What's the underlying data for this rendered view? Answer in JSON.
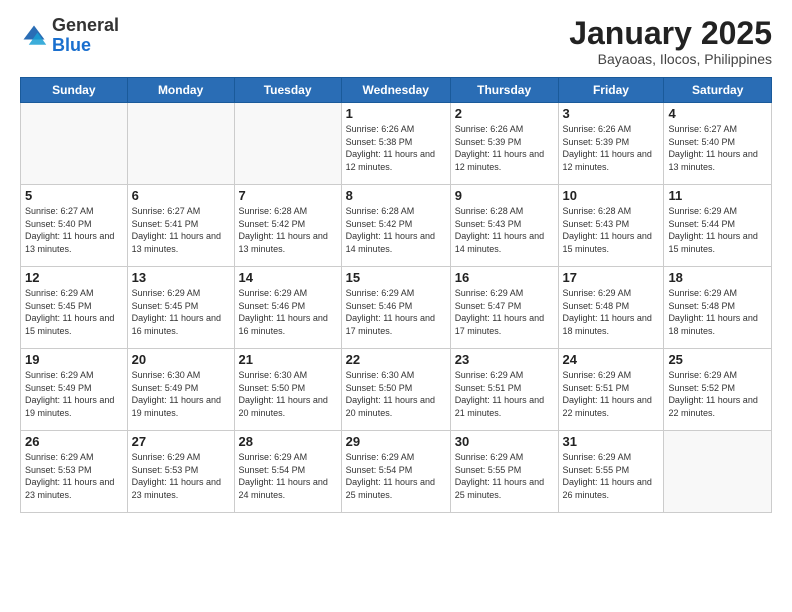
{
  "logo": {
    "general": "General",
    "blue": "Blue"
  },
  "header": {
    "title": "January 2025",
    "subtitle": "Bayaoas, Ilocos, Philippines"
  },
  "weekdays": [
    "Sunday",
    "Monday",
    "Tuesday",
    "Wednesday",
    "Thursday",
    "Friday",
    "Saturday"
  ],
  "weeks": [
    [
      {
        "day": "",
        "sunrise": "",
        "sunset": "",
        "daylight": ""
      },
      {
        "day": "",
        "sunrise": "",
        "sunset": "",
        "daylight": ""
      },
      {
        "day": "",
        "sunrise": "",
        "sunset": "",
        "daylight": ""
      },
      {
        "day": "1",
        "sunrise": "Sunrise: 6:26 AM",
        "sunset": "Sunset: 5:38 PM",
        "daylight": "Daylight: 11 hours and 12 minutes."
      },
      {
        "day": "2",
        "sunrise": "Sunrise: 6:26 AM",
        "sunset": "Sunset: 5:39 PM",
        "daylight": "Daylight: 11 hours and 12 minutes."
      },
      {
        "day": "3",
        "sunrise": "Sunrise: 6:26 AM",
        "sunset": "Sunset: 5:39 PM",
        "daylight": "Daylight: 11 hours and 12 minutes."
      },
      {
        "day": "4",
        "sunrise": "Sunrise: 6:27 AM",
        "sunset": "Sunset: 5:40 PM",
        "daylight": "Daylight: 11 hours and 13 minutes."
      }
    ],
    [
      {
        "day": "5",
        "sunrise": "Sunrise: 6:27 AM",
        "sunset": "Sunset: 5:40 PM",
        "daylight": "Daylight: 11 hours and 13 minutes."
      },
      {
        "day": "6",
        "sunrise": "Sunrise: 6:27 AM",
        "sunset": "Sunset: 5:41 PM",
        "daylight": "Daylight: 11 hours and 13 minutes."
      },
      {
        "day": "7",
        "sunrise": "Sunrise: 6:28 AM",
        "sunset": "Sunset: 5:42 PM",
        "daylight": "Daylight: 11 hours and 13 minutes."
      },
      {
        "day": "8",
        "sunrise": "Sunrise: 6:28 AM",
        "sunset": "Sunset: 5:42 PM",
        "daylight": "Daylight: 11 hours and 14 minutes."
      },
      {
        "day": "9",
        "sunrise": "Sunrise: 6:28 AM",
        "sunset": "Sunset: 5:43 PM",
        "daylight": "Daylight: 11 hours and 14 minutes."
      },
      {
        "day": "10",
        "sunrise": "Sunrise: 6:28 AM",
        "sunset": "Sunset: 5:43 PM",
        "daylight": "Daylight: 11 hours and 15 minutes."
      },
      {
        "day": "11",
        "sunrise": "Sunrise: 6:29 AM",
        "sunset": "Sunset: 5:44 PM",
        "daylight": "Daylight: 11 hours and 15 minutes."
      }
    ],
    [
      {
        "day": "12",
        "sunrise": "Sunrise: 6:29 AM",
        "sunset": "Sunset: 5:45 PM",
        "daylight": "Daylight: 11 hours and 15 minutes."
      },
      {
        "day": "13",
        "sunrise": "Sunrise: 6:29 AM",
        "sunset": "Sunset: 5:45 PM",
        "daylight": "Daylight: 11 hours and 16 minutes."
      },
      {
        "day": "14",
        "sunrise": "Sunrise: 6:29 AM",
        "sunset": "Sunset: 5:46 PM",
        "daylight": "Daylight: 11 hours and 16 minutes."
      },
      {
        "day": "15",
        "sunrise": "Sunrise: 6:29 AM",
        "sunset": "Sunset: 5:46 PM",
        "daylight": "Daylight: 11 hours and 17 minutes."
      },
      {
        "day": "16",
        "sunrise": "Sunrise: 6:29 AM",
        "sunset": "Sunset: 5:47 PM",
        "daylight": "Daylight: 11 hours and 17 minutes."
      },
      {
        "day": "17",
        "sunrise": "Sunrise: 6:29 AM",
        "sunset": "Sunset: 5:48 PM",
        "daylight": "Daylight: 11 hours and 18 minutes."
      },
      {
        "day": "18",
        "sunrise": "Sunrise: 6:29 AM",
        "sunset": "Sunset: 5:48 PM",
        "daylight": "Daylight: 11 hours and 18 minutes."
      }
    ],
    [
      {
        "day": "19",
        "sunrise": "Sunrise: 6:29 AM",
        "sunset": "Sunset: 5:49 PM",
        "daylight": "Daylight: 11 hours and 19 minutes."
      },
      {
        "day": "20",
        "sunrise": "Sunrise: 6:30 AM",
        "sunset": "Sunset: 5:49 PM",
        "daylight": "Daylight: 11 hours and 19 minutes."
      },
      {
        "day": "21",
        "sunrise": "Sunrise: 6:30 AM",
        "sunset": "Sunset: 5:50 PM",
        "daylight": "Daylight: 11 hours and 20 minutes."
      },
      {
        "day": "22",
        "sunrise": "Sunrise: 6:30 AM",
        "sunset": "Sunset: 5:50 PM",
        "daylight": "Daylight: 11 hours and 20 minutes."
      },
      {
        "day": "23",
        "sunrise": "Sunrise: 6:29 AM",
        "sunset": "Sunset: 5:51 PM",
        "daylight": "Daylight: 11 hours and 21 minutes."
      },
      {
        "day": "24",
        "sunrise": "Sunrise: 6:29 AM",
        "sunset": "Sunset: 5:51 PM",
        "daylight": "Daylight: 11 hours and 22 minutes."
      },
      {
        "day": "25",
        "sunrise": "Sunrise: 6:29 AM",
        "sunset": "Sunset: 5:52 PM",
        "daylight": "Daylight: 11 hours and 22 minutes."
      }
    ],
    [
      {
        "day": "26",
        "sunrise": "Sunrise: 6:29 AM",
        "sunset": "Sunset: 5:53 PM",
        "daylight": "Daylight: 11 hours and 23 minutes."
      },
      {
        "day": "27",
        "sunrise": "Sunrise: 6:29 AM",
        "sunset": "Sunset: 5:53 PM",
        "daylight": "Daylight: 11 hours and 23 minutes."
      },
      {
        "day": "28",
        "sunrise": "Sunrise: 6:29 AM",
        "sunset": "Sunset: 5:54 PM",
        "daylight": "Daylight: 11 hours and 24 minutes."
      },
      {
        "day": "29",
        "sunrise": "Sunrise: 6:29 AM",
        "sunset": "Sunset: 5:54 PM",
        "daylight": "Daylight: 11 hours and 25 minutes."
      },
      {
        "day": "30",
        "sunrise": "Sunrise: 6:29 AM",
        "sunset": "Sunset: 5:55 PM",
        "daylight": "Daylight: 11 hours and 25 minutes."
      },
      {
        "day": "31",
        "sunrise": "Sunrise: 6:29 AM",
        "sunset": "Sunset: 5:55 PM",
        "daylight": "Daylight: 11 hours and 26 minutes."
      },
      {
        "day": "",
        "sunrise": "",
        "sunset": "",
        "daylight": ""
      }
    ]
  ]
}
